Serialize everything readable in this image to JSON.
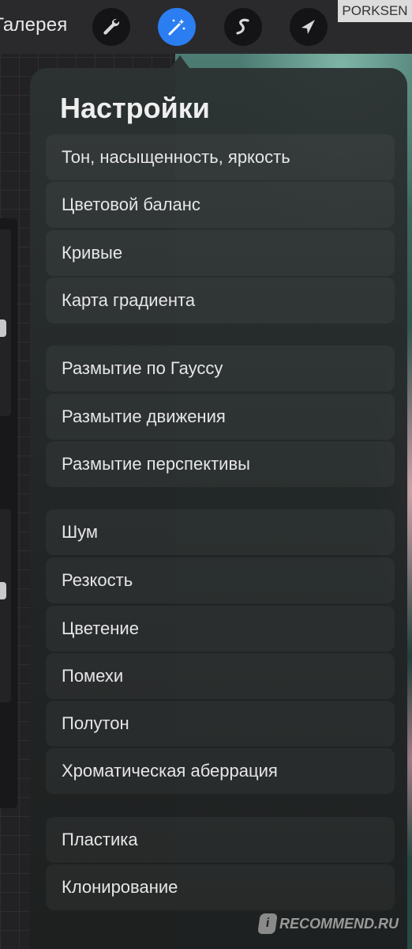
{
  "toolbar": {
    "gallery_label": "Галерея",
    "tools": [
      "wrench-icon",
      "magic-wand-icon",
      "smudge-s-icon",
      "selection-arrow-icon"
    ],
    "active_tool": "magic-wand-icon",
    "accent": "#2b7ef2"
  },
  "watermark_top": "PORKSEN",
  "adjustments": {
    "title": "Настройки",
    "items": [
      "Тон, насыщенность, яркость",
      "Цветовой баланс",
      "Кривые",
      "Карта градиента",
      "Размытие по Гауссу",
      "Размытие движения",
      "Размытие перспективы",
      "Шум",
      "Резкость",
      "Цветение",
      "Помехи",
      "Полутон",
      "Хроматическая аберрация",
      "Пластика",
      "Клонирование"
    ]
  },
  "watermark_bottom": {
    "logo": "i",
    "text": "RECOMMEND.RU"
  }
}
